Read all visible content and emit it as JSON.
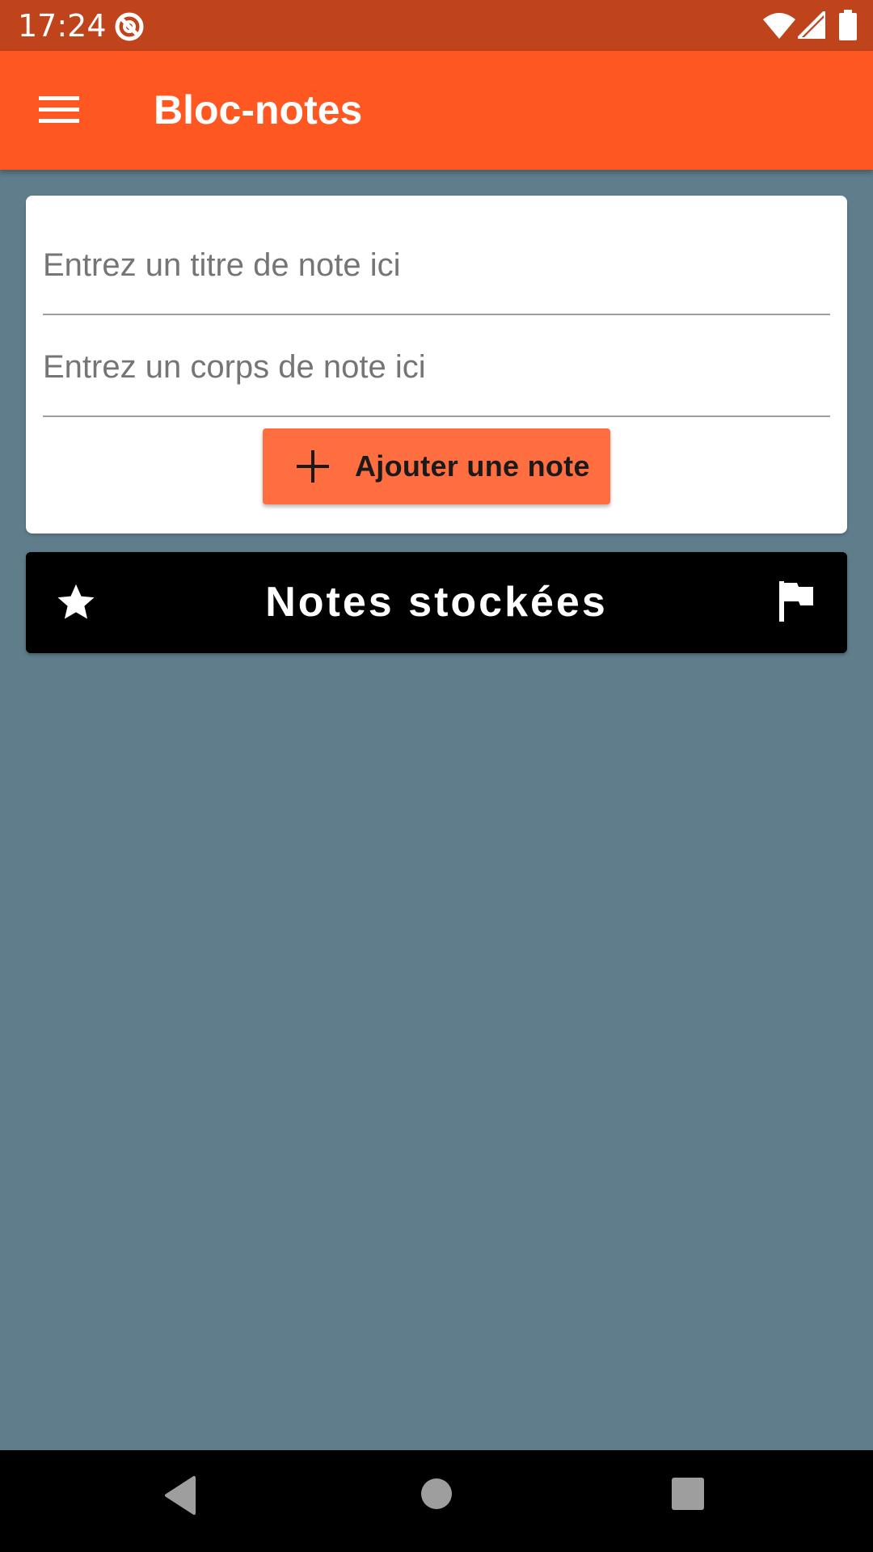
{
  "status_bar": {
    "time": "17:24",
    "icons": [
      "at-sign-icon",
      "wifi-icon",
      "signal-icon",
      "battery-icon"
    ]
  },
  "app_bar": {
    "menu_icon": "menu-icon",
    "title": "Bloc-notes"
  },
  "form": {
    "title_placeholder": "Entrez un titre de note ici",
    "body_placeholder": "Entrez un corps de note ici",
    "add_button_icon": "plus-icon",
    "add_button_label": "Ajouter une note"
  },
  "stored_notes": {
    "left_icon": "star-icon",
    "title": "Notes stockées",
    "right_icon": "flag-icon"
  },
  "navigation": {
    "buttons": [
      "back-icon",
      "home-icon",
      "recents-icon"
    ]
  },
  "colors": {
    "status_bar": "#bf431b",
    "app_bar": "#ff5722",
    "background": "#607d8b",
    "add_button": "#ff6e40",
    "stored_bar": "#000000"
  }
}
